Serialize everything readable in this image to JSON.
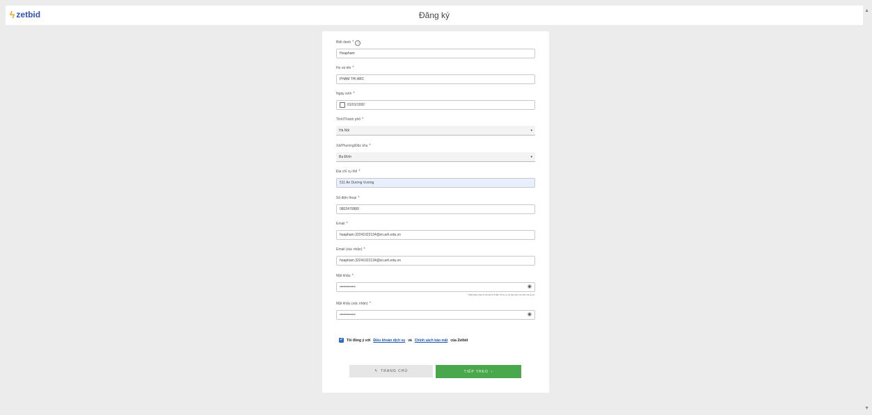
{
  "app": {
    "logo_text": "zetbid",
    "page_title": "Đăng ký"
  },
  "form": {
    "nickname": {
      "label": "Biệt danh",
      "value": "Hoapham"
    },
    "fullname": {
      "label": "Họ và tên",
      "value": "PHẠM THỊ ABC"
    },
    "dob": {
      "label": "Ngày sinh",
      "value": "01/01/1992"
    },
    "province": {
      "label": "Tỉnh/Thành phố",
      "value": "Hà Nội"
    },
    "ward": {
      "label": "Xã/Phường/Đặc khu",
      "value": "Ba Đình"
    },
    "address": {
      "label": "Địa chỉ cụ thể",
      "value": "511 An Dương Vương"
    },
    "phone": {
      "label": "Số điện thoại",
      "value": "0802470889"
    },
    "email": {
      "label": "Email",
      "value": "hoapham.32241022134@st.ueh.edu.vn"
    },
    "email_confirm": {
      "label": "Email (xác nhận)",
      "value": "hoapham.32241022134@st.ueh.edu.vn"
    },
    "password": {
      "label": "Mật khẩu",
      "value": "•••••••••••••",
      "hint": "* Mật khẩu phải có độ dài từ 8 đến 14 ký tự và bao gồm cả chữ cái và số."
    },
    "password_confirm": {
      "label": "Mật khẩu (xác nhận)",
      "value": "•••••••••••••"
    },
    "required_mark": "*"
  },
  "agreement": {
    "prefix": "Tôi đồng ý với",
    "terms": "Điều khoản dịch vụ",
    "and": "và",
    "privacy": "Chính sách bảo mật",
    "suffix": "của Zetbid"
  },
  "buttons": {
    "home": "TRANG CHỦ",
    "next": "TIẾP THEO"
  },
  "icons": {
    "home": "↰",
    "next": "›",
    "eye": "◉",
    "chevron": "▾",
    "check": "✓"
  }
}
